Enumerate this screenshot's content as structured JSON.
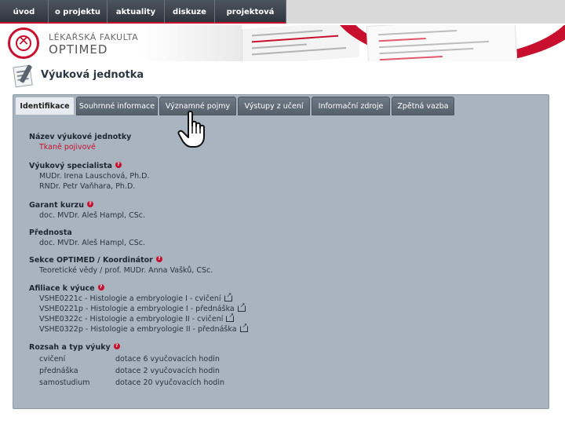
{
  "nav": {
    "items": [
      {
        "label": "úvod"
      },
      {
        "label": "o projektu"
      },
      {
        "label": "aktuality"
      },
      {
        "label": "diskuze"
      },
      {
        "label": "projektová agenda"
      }
    ]
  },
  "header": {
    "faculty": "LÉKAŘSKÁ FAKULTA",
    "brand": "OPTIMED"
  },
  "page": {
    "title": "Výuková jednotka"
  },
  "tabs": [
    {
      "label": "Identifikace",
      "active": true
    },
    {
      "label": "Souhrnné informace",
      "active": false
    },
    {
      "label": "Významné pojmy",
      "active": false
    },
    {
      "label": "Výstupy z učení",
      "active": false
    },
    {
      "label": "Informační zdroje",
      "active": false
    },
    {
      "label": "Zpětná vazba",
      "active": false
    }
  ],
  "identification": {
    "unit_name": {
      "label": "Název výukové jednotky",
      "value": "Tkaně pojivové"
    },
    "specialist": {
      "label": "Výukový specialista",
      "values": [
        "MUDr. Irena Lauschová, Ph.D.",
        "RNDr. Petr Vaňhara, Ph.D."
      ]
    },
    "guarantor": {
      "label": "Garant kurzu",
      "value": "doc. MVDr. Aleš Hampl, CSc."
    },
    "head": {
      "label": "Přednosta",
      "value": "doc. MVDr. Aleš Hampl, CSc."
    },
    "section": {
      "label": "Sekce OPTIMED / Koordinátor",
      "value": "Teoretické vědy / prof. MUDr. Anna Vašků, CSc."
    },
    "affiliation": {
      "label": "Afiliace k výuce",
      "items": [
        "VSHE0221c - Histologie a embryologie I - cvičení",
        "VSHE0221p - Histologie a embryologie I - přednáška",
        "VSHE0322c - Histologie a embryologie II - cvičení",
        "VSHE0322p - Histologie a embryologie II - přednáška"
      ]
    },
    "scope": {
      "label": "Rozsah a typ výuky",
      "rows": [
        {
          "type": "cvičení",
          "amount": "dotace 6 vyučovacích hodin"
        },
        {
          "type": "přednáška",
          "amount": "dotace 2 vyučovacích hodin"
        },
        {
          "type": "samostudium",
          "amount": "dotace 20 vyučovacích hodin"
        }
      ]
    }
  },
  "colors": {
    "accent": "#c8102e",
    "nav_bg": "#3c434c",
    "panel_bg": "#a8b4c0",
    "tab_bg": "#606c78"
  },
  "icons": {
    "help": "help-icon",
    "external": "external-link-icon",
    "cursor": "hand-pointer-icon"
  }
}
